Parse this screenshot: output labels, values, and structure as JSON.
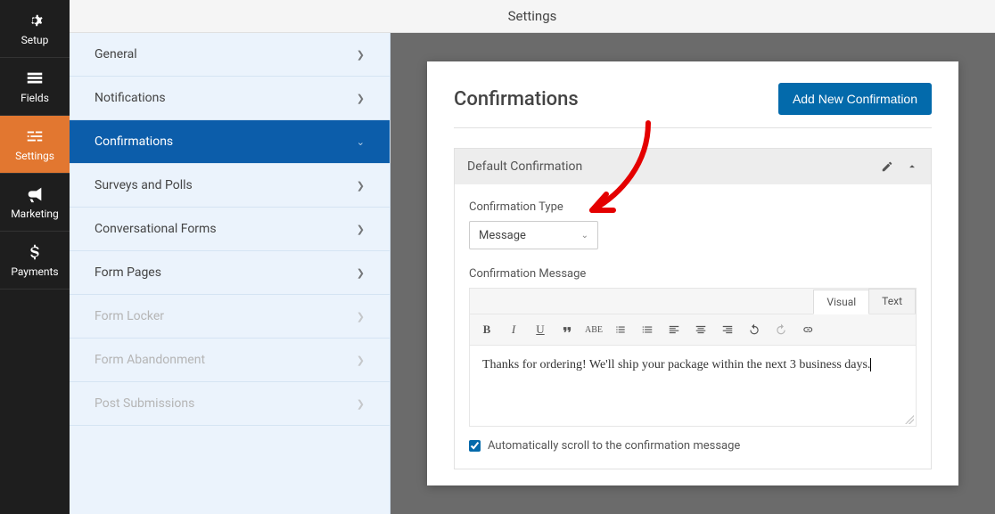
{
  "topbar": {
    "title": "Settings"
  },
  "nav": {
    "items": [
      {
        "label": "Setup",
        "icon": "gear"
      },
      {
        "label": "Fields",
        "icon": "list"
      },
      {
        "label": "Settings",
        "icon": "sliders",
        "active": true
      },
      {
        "label": "Marketing",
        "icon": "bullhorn"
      },
      {
        "label": "Payments",
        "icon": "dollar"
      }
    ]
  },
  "settings_menu": {
    "items": [
      {
        "label": "General"
      },
      {
        "label": "Notifications"
      },
      {
        "label": "Confirmations",
        "active": true,
        "expanded": true
      },
      {
        "label": "Surveys and Polls"
      },
      {
        "label": "Conversational Forms"
      },
      {
        "label": "Form Pages"
      },
      {
        "label": "Form Locker",
        "disabled": true
      },
      {
        "label": "Form Abandonment",
        "disabled": true
      },
      {
        "label": "Post Submissions",
        "disabled": true
      }
    ]
  },
  "card": {
    "title": "Confirmations",
    "add_button": "Add New Confirmation"
  },
  "panel": {
    "title": "Default Confirmation",
    "confirmation_type_label": "Confirmation Type",
    "confirmation_type_value": "Message",
    "confirmation_message_label": "Confirmation Message",
    "tabs": {
      "visual": "Visual",
      "text": "Text"
    },
    "message_body": "Thanks for ordering! We'll ship your package within the next 3 business days.",
    "auto_scroll_label": "Automatically scroll to the confirmation message",
    "auto_scroll_checked": true
  }
}
